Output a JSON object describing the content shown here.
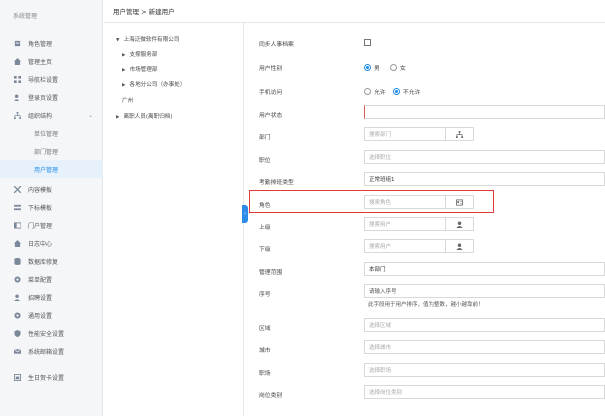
{
  "sidebar": {
    "title": "系统管理",
    "items": [
      {
        "label": "角色管理",
        "icon": "role-icon"
      },
      {
        "label": "管理主页",
        "icon": "home-admin-icon"
      },
      {
        "label": "导航栏设置",
        "icon": "nav-settings-icon"
      },
      {
        "label": "登录页设置",
        "icon": "login-settings-icon"
      },
      {
        "label": "组织结构",
        "icon": "org-structure-icon",
        "expanded": true
      },
      {
        "label": "单位管理"
      },
      {
        "label": "部门管理"
      },
      {
        "label": "用户管理",
        "active": true
      },
      {
        "label": "内容模板",
        "icon": "content-template-icon"
      },
      {
        "label": "下标模板",
        "icon": "subscript-template-icon"
      },
      {
        "label": "门户管理",
        "icon": "portal-icon"
      },
      {
        "label": "日志中心",
        "icon": "log-icon"
      },
      {
        "label": "数据库修复",
        "icon": "database-icon"
      },
      {
        "label": "菜单配置",
        "icon": "menu-config-icon"
      },
      {
        "label": "招聘设置",
        "icon": "recruit-icon"
      },
      {
        "label": "通用设置",
        "icon": "general-settings-icon"
      },
      {
        "label": "性能安全设置",
        "icon": "security-icon"
      },
      {
        "label": "系统邮箱设置",
        "icon": "mail-icon"
      },
      {
        "label": "生日贺卡设置",
        "icon": "birthday-card-icon"
      }
    ]
  },
  "breadcrumb": "用户管理 > 新建用户",
  "tree": {
    "nodes": [
      {
        "label": "上海泛微软件有限公司",
        "toggle": "▼"
      },
      {
        "label": "支撑服务部",
        "toggle": "▶"
      },
      {
        "label": "市场管理部",
        "toggle": "▶"
      },
      {
        "label": "各地分公司（办事处）",
        "toggle": "▶"
      },
      {
        "label": "广州",
        "toggle": ""
      },
      {
        "label": "离职人员(离职归档)",
        "toggle": "▶"
      }
    ]
  },
  "form": {
    "sync_hr_label": "同步人事档案",
    "gender_label": "用户性别",
    "gender_male": "男",
    "gender_female": "女",
    "mobile_access_label": "手机访问",
    "allow": "允许",
    "disallow": "不允许",
    "status_label": "用户状态",
    "dept_label": "部门",
    "dept_placeholder": "搜索部门",
    "position_label": "职位",
    "position_placeholder": "选择职位",
    "attendance_label": "考勤排班类型",
    "attendance_value": "正常班组1",
    "role_label": "角色",
    "role_placeholder": "搜索角色",
    "superior_label": "上级",
    "superior_placeholder": "搜索用户",
    "subordinate_label": "下级",
    "subordinate_placeholder": "搜索用户",
    "scope_label": "管理范围",
    "scope_value": "本部门",
    "serial_label": "序号",
    "serial_placeholder": "请输入序号",
    "serial_hint": "此字段用于用户排序，值为整数，越小越靠前！",
    "region_label": "区域",
    "region_placeholder": "选择区域",
    "city_label": "城市",
    "city_placeholder": "选择城市",
    "rank_label": "职场",
    "rank_placeholder": "选择职场",
    "post_label": "岗位类别",
    "post_placeholder": "选择岗位类别"
  }
}
